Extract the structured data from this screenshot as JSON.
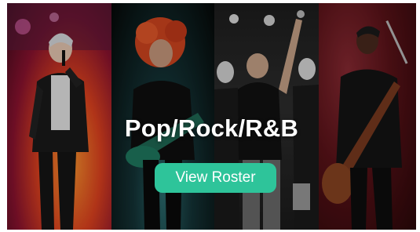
{
  "banner": {
    "headline": "Pop/Rock/R&B",
    "cta_label": "View Roster"
  },
  "colors": {
    "cta_background": "#2ec49a",
    "headline_text": "#ffffff"
  },
  "images": [
    "singer-with-microphone-photo",
    "guitarist-red-hair-photo",
    "masked-band-performance-photo",
    "guitarist-red-stage-photo"
  ]
}
